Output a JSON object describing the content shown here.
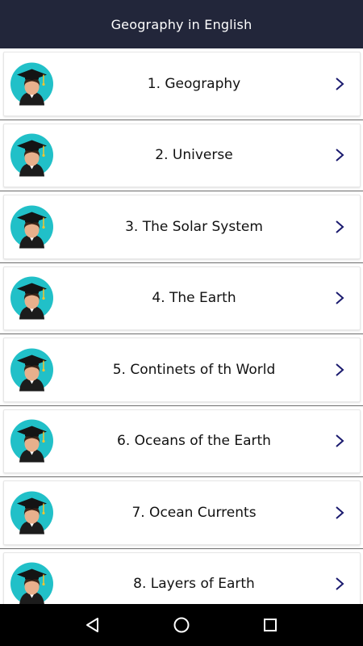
{
  "header": {
    "title": "Geography in English"
  },
  "items": [
    {
      "label": "1. Geography"
    },
    {
      "label": "2. Universe"
    },
    {
      "label": "3. The Solar System"
    },
    {
      "label": "4. The Earth"
    },
    {
      "label": "5. Continets of th World"
    },
    {
      "label": "6. Oceans of the Earth"
    },
    {
      "label": "7. Ocean Currents"
    },
    {
      "label": "8. Layers of Earth"
    }
  ],
  "icons": {
    "avatar": "graduate-avatar-icon",
    "chevron": "chevron-right-icon",
    "nav_back": "back-triangle-icon",
    "nav_home": "home-circle-icon",
    "nav_recents": "recents-square-icon"
  },
  "colors": {
    "app_bar": "#22263a",
    "avatar_bg": "#21c0c8",
    "chevron": "#1a1a6e",
    "nav_bar": "#000000"
  }
}
